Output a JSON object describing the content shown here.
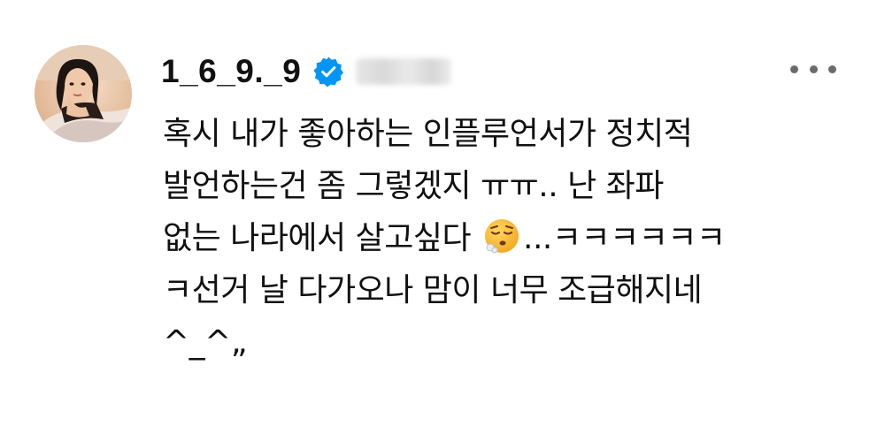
{
  "post": {
    "author": {
      "username": "1_6_9._9",
      "verified": true,
      "avatar_icon": "profile-photo",
      "handle_blurred": true
    },
    "more_icon": "more-horizontal-icon",
    "text_lines": {
      "l1": "혹시 내가 좋아하는 인플루언서가 정치적",
      "l2": "발언하는건 좀 그렇겠지 ㅠㅠ.. 난 좌파",
      "l3a": "없는 나라에서 살고싶다",
      "l3b": "...ㅋㅋㅋㅋㅋㅋ",
      "l4": "ㅋ선거 날 다가오나 맘이 너무 조급해지네",
      "l5": "^_^„"
    },
    "emoji": "face-exhaling-icon"
  },
  "colors": {
    "verified_blue": "#0095f6",
    "text": "#111111",
    "muted": "#6b6b6b",
    "background": "#ffffff"
  }
}
